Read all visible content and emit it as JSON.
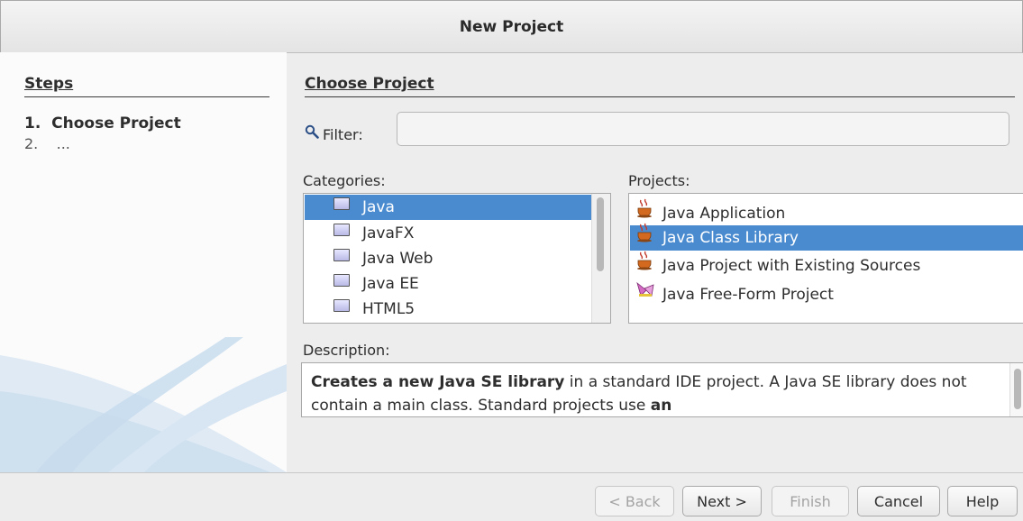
{
  "window": {
    "title": "New Project"
  },
  "steps": {
    "heading": "Steps",
    "items": [
      {
        "num": "1.",
        "label": "Choose Project"
      },
      {
        "num": "2.",
        "label": "..."
      }
    ]
  },
  "main": {
    "heading": "Choose Project",
    "filter": {
      "label": "Filter:",
      "value": "",
      "placeholder": ""
    },
    "categories": {
      "label": "Categories:",
      "items": [
        "Java",
        "JavaFX",
        "Java Web",
        "Java EE",
        "HTML5"
      ],
      "selected": "Java"
    },
    "projects": {
      "label": "Projects:",
      "items": [
        "Java Application",
        "Java Class Library",
        "Java Project with Existing Sources",
        "Java Free-Form Project"
      ],
      "selected": "Java Class Library"
    },
    "description": {
      "label": "Description:",
      "bold1": "Creates a new Java SE library",
      "text1": " in a standard IDE project. A Java SE library does not contain a main class. Standard projects use ",
      "bold2": "an"
    }
  },
  "buttons": {
    "back": "< Back",
    "next": "Next >",
    "finish": "Finish",
    "cancel": "Cancel",
    "help": "Help"
  }
}
